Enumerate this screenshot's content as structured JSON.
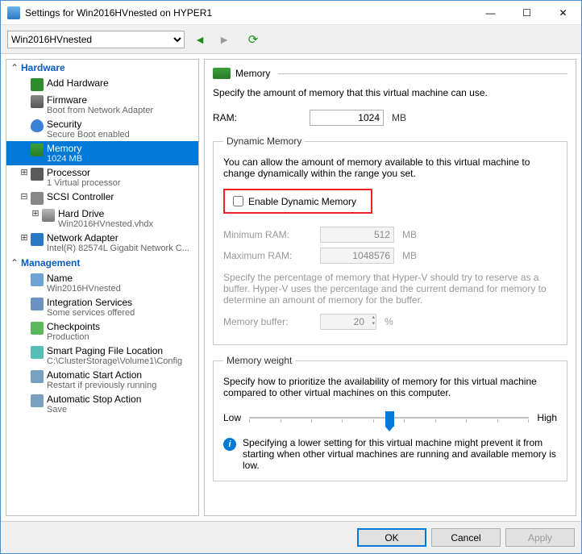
{
  "window": {
    "title": "Settings for Win2016HVnested on HYPER1",
    "minimize": "—",
    "maximize": "☐",
    "close": "✕"
  },
  "toolbar": {
    "selected_vm": "Win2016HVnested"
  },
  "tree": {
    "hardware": "Hardware",
    "management": "Management",
    "add_hardware": "Add Hardware",
    "firmware": {
      "label": "Firmware",
      "sub": "Boot from Network Adapter"
    },
    "security": {
      "label": "Security",
      "sub": "Secure Boot enabled"
    },
    "memory": {
      "label": "Memory",
      "sub": "1024 MB"
    },
    "processor": {
      "label": "Processor",
      "sub": "1 Virtual processor"
    },
    "scsi": {
      "label": "SCSI Controller"
    },
    "harddrive": {
      "label": "Hard Drive",
      "sub": "Win2016HVnested.vhdx"
    },
    "netadapter": {
      "label": "Network Adapter",
      "sub": "Intel(R) 82574L Gigabit Network C..."
    },
    "name": {
      "label": "Name",
      "sub": "Win2016HVnested"
    },
    "integration": {
      "label": "Integration Services",
      "sub": "Some services offered"
    },
    "checkpoints": {
      "label": "Checkpoints",
      "sub": "Production"
    },
    "paging": {
      "label": "Smart Paging File Location",
      "sub": "C:\\ClusterStorage\\Volume1\\Config"
    },
    "autostart": {
      "label": "Automatic Start Action",
      "sub": "Restart if previously running"
    },
    "autostop": {
      "label": "Automatic Stop Action",
      "sub": "Save"
    }
  },
  "panel": {
    "title": "Memory",
    "intro": "Specify the amount of memory that this virtual machine can use.",
    "ram_label": "RAM:",
    "ram_value": "1024",
    "mb": "MB",
    "dyn": {
      "legend": "Dynamic Memory",
      "desc": "You can allow the amount of memory available to this virtual machine to change dynamically within the range you set.",
      "enable_label": "Enable Dynamic Memory",
      "min_label": "Minimum RAM:",
      "min_value": "512",
      "max_label": "Maximum RAM:",
      "max_value": "1048576",
      "buffer_desc": "Specify the percentage of memory that Hyper-V should try to reserve as a buffer. Hyper-V uses the percentage and the current demand for memory to determine an amount of memory for the buffer.",
      "buffer_label": "Memory buffer:",
      "buffer_value": "20",
      "percent": "%"
    },
    "weight": {
      "legend": "Memory weight",
      "desc": "Specify how to prioritize the availability of memory for this virtual machine compared to other virtual machines on this computer.",
      "low": "Low",
      "high": "High",
      "info": "Specifying a lower setting for this virtual machine might prevent it from starting when other virtual machines are running and available memory is low."
    }
  },
  "buttons": {
    "ok": "OK",
    "cancel": "Cancel",
    "apply": "Apply"
  }
}
